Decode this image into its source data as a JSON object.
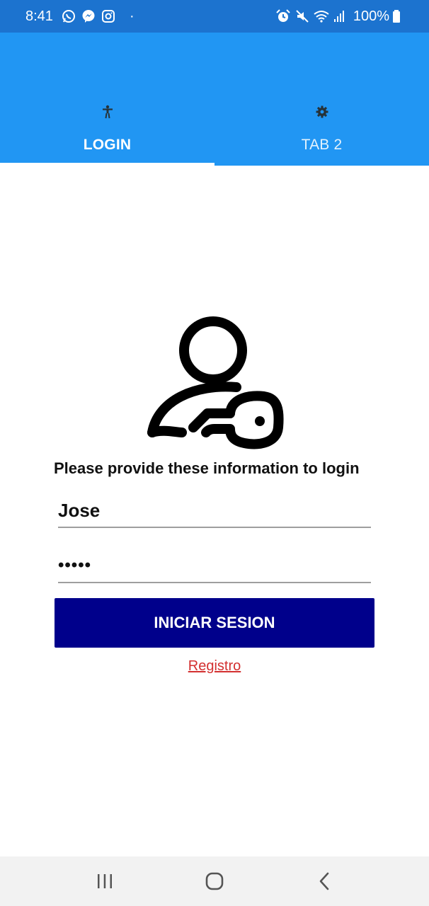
{
  "status_bar": {
    "time": "8:41",
    "left_icons": [
      "whatsapp-icon",
      "messenger-icon",
      "instagram-icon"
    ],
    "dot": "·",
    "right_icons": [
      "alarm-icon",
      "mute-icon",
      "wifi-icon",
      "signal-icon",
      "battery-icon"
    ],
    "battery": "100%"
  },
  "tabs": [
    {
      "label": "LOGIN",
      "icon": "accessibility-icon",
      "selected": true
    },
    {
      "label": "TAB 2",
      "icon": "gear-icon",
      "selected": false
    }
  ],
  "login": {
    "illustration_icon": "user-key-icon",
    "prompt": "Please provide these information to login",
    "username_value": "Jose",
    "password_value": "•••••",
    "submit_label": "INICIAR SESION",
    "register_label": "Registro"
  },
  "nav_bar": {
    "buttons": [
      "recent-apps-icon",
      "home-icon",
      "back-icon"
    ]
  },
  "colors": {
    "status_bar": "#1C73CF",
    "app_bar": "#2196F3",
    "submit_button": "#00008B",
    "register_link": "#D32F2F",
    "nav_bar": "#F2F2F2"
  }
}
